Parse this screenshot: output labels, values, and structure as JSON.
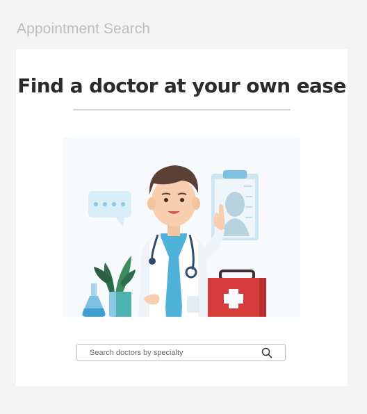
{
  "page": {
    "heading": "Appointment Search"
  },
  "card": {
    "title": "Find a doctor at your own ease"
  },
  "search": {
    "placeholder": "Search doctors by specialty",
    "value": "",
    "icon": "search-icon"
  },
  "illustration": {
    "subject": "doctor-illustration"
  },
  "colors": {
    "background": "#f4f4f4",
    "card": "#ffffff",
    "title": "#2b2b2b",
    "heading": "#bdbdbd",
    "accent_blue": "#4fb3d9",
    "kit_red": "#d63b3b"
  }
}
